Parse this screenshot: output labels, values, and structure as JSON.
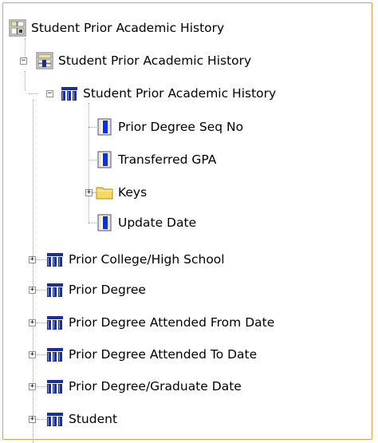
{
  "tree": {
    "root": {
      "label": "Student Prior Academic History",
      "icon": "cube-icon"
    },
    "level1": {
      "label": "Student Prior Academic History",
      "icon": "cube-icon",
      "expanded": true
    },
    "level2_main": {
      "label": "Student Prior Academic History",
      "icon": "dimension-icon",
      "expanded": true
    },
    "level3": [
      {
        "label": "Prior Degree Seq No",
        "icon": "attribute-icon"
      },
      {
        "label": "Transferred GPA",
        "icon": "attribute-icon"
      },
      {
        "label": "Keys",
        "icon": "folder-icon",
        "expandable": true
      },
      {
        "label": "Update Date",
        "icon": "attribute-icon"
      }
    ],
    "level2_others": [
      {
        "label": "Prior College/High School",
        "icon": "dimension-icon"
      },
      {
        "label": "Prior Degree",
        "icon": "dimension-icon"
      },
      {
        "label": "Prior Degree Attended From Date",
        "icon": "dimension-icon"
      },
      {
        "label": "Prior Degree Attended To Date",
        "icon": "dimension-icon"
      },
      {
        "label": "Prior Degree/Graduate Date",
        "icon": "dimension-icon"
      },
      {
        "label": "Student",
        "icon": "dimension-icon"
      }
    ]
  },
  "colors": {
    "frame_border": "#e0a050",
    "dimension_blue": "#1b2f9a",
    "attribute_blue": "#1030d0",
    "folder_yellow": "#f7d860"
  }
}
